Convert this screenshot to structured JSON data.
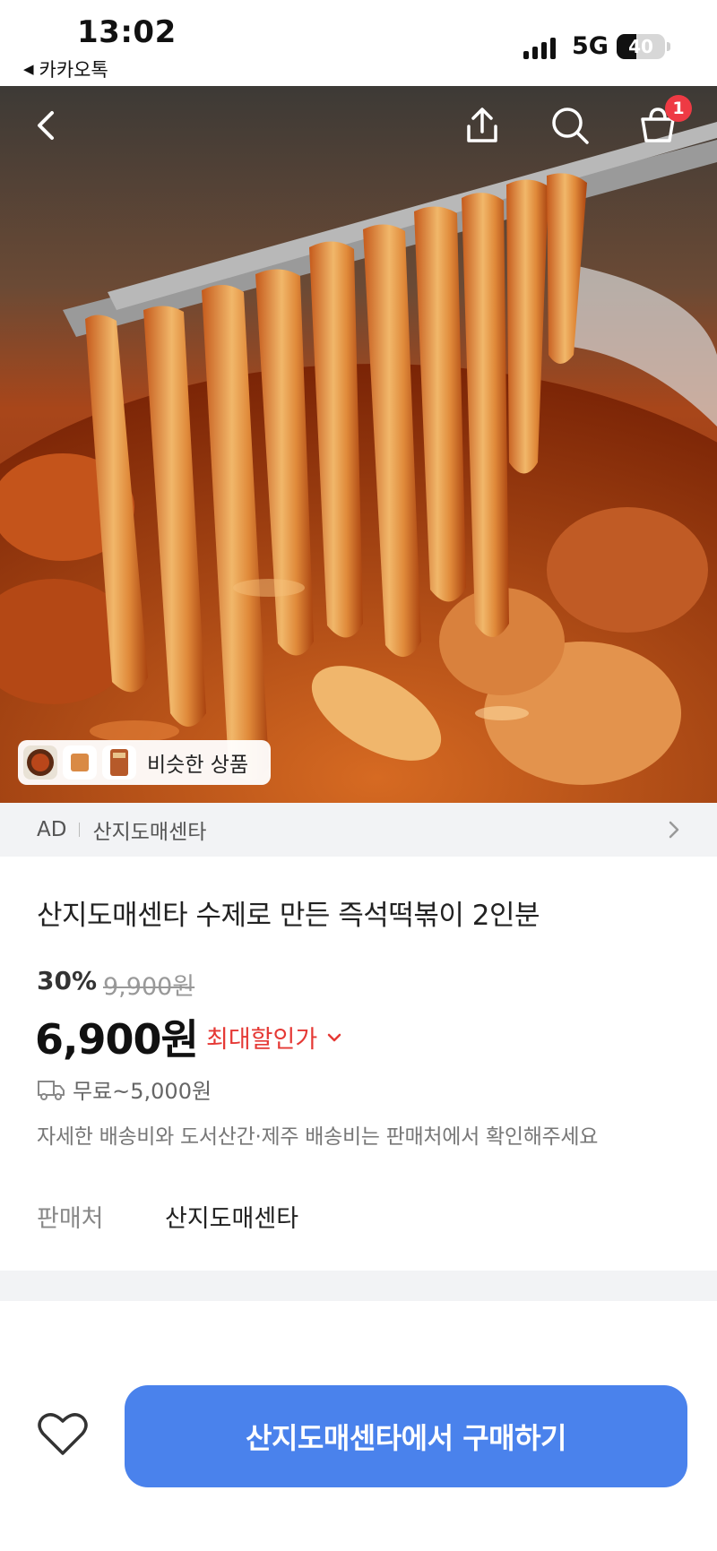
{
  "status_bar": {
    "time": "13:02",
    "back_app": "카카오톡",
    "network": "5G",
    "battery": "40",
    "battery_level_pct": 40
  },
  "header": {
    "icons": [
      "back-arrow-icon",
      "share-icon",
      "search-icon",
      "cart-icon"
    ],
    "cart_badge": "1"
  },
  "hero": {
    "similar_label": "비슷한 상품"
  },
  "ad_bar": {
    "ad": "AD",
    "seller": "산지도매센타"
  },
  "product": {
    "title": "산지도매센타 수제로 만든 즉석떡볶이 2인분",
    "discount": "30%",
    "original_price": "9,900원",
    "price": "6,900원",
    "max_discount_label": "최대할인가",
    "shipping": "무료~5,000원",
    "shipping_note": "자세한 배송비와 도서산간·제주 배송비는 판매처에서 확인해주세요",
    "seller_label": "판매처",
    "seller_value": "산지도매센타"
  },
  "footer": {
    "buy_label": "산지도매센타에서 구매하기"
  },
  "colors": {
    "accent_blue": "#4a82ec",
    "discount_red": "#e53935",
    "badge_red": "#ee3a44"
  }
}
